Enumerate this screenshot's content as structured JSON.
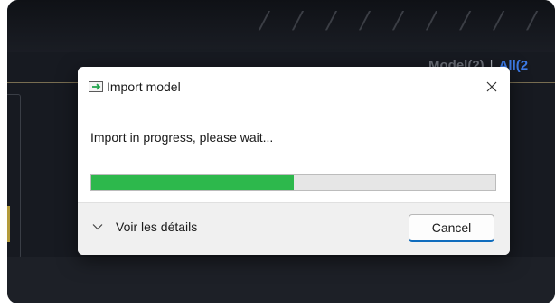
{
  "background_app": {
    "tabs": [
      {
        "label": "Model(2)"
      },
      {
        "separator": "|"
      },
      {
        "label": "All(2"
      }
    ],
    "accent_color": "#3d7be8"
  },
  "dialog": {
    "title": "Import model",
    "title_icon": "import-arrow-icon",
    "close_icon": "close-icon",
    "message": "Import in progress, please wait...",
    "progress": {
      "fraction": 0.5,
      "fill_color": "#2db84c"
    },
    "details_toggle": {
      "icon": "chevron-down-icon",
      "label": "Voir les détails"
    },
    "cancel_label": "Cancel"
  }
}
